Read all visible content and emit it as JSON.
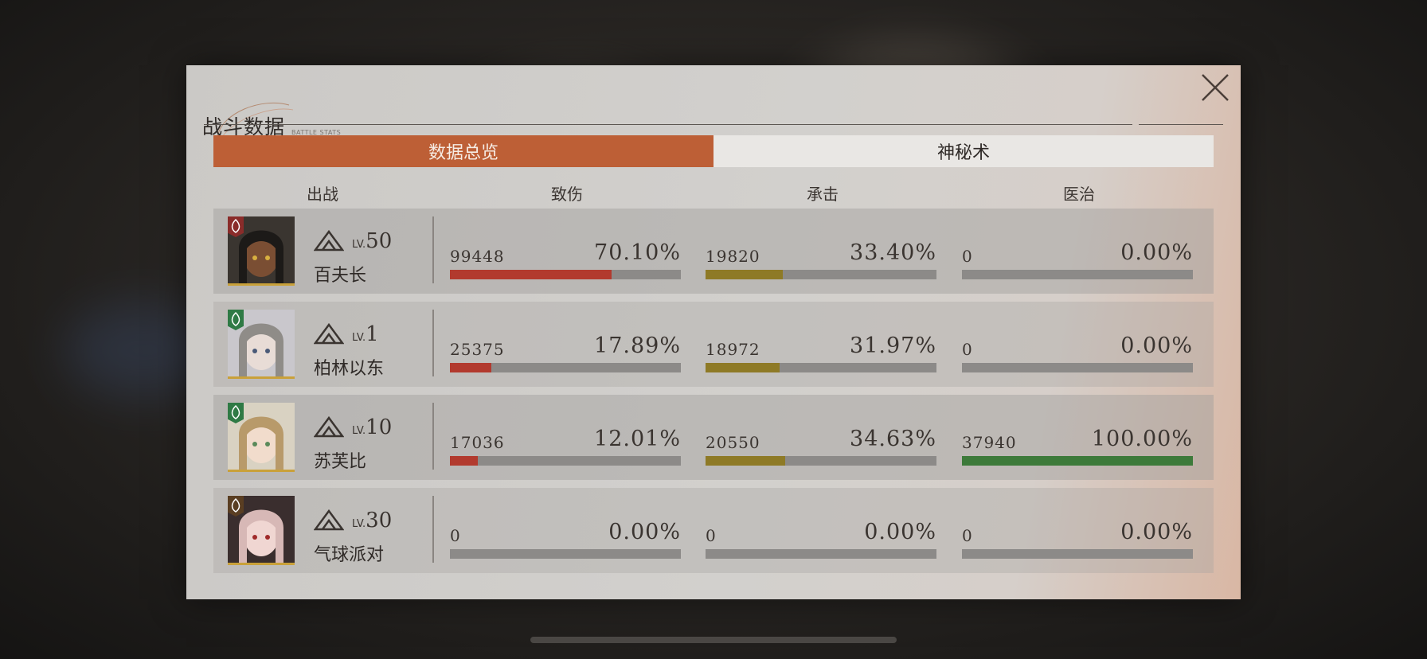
{
  "dialog": {
    "title": "战斗数据",
    "subtitle": "BATTLE STATS",
    "close_icon": "close-icon"
  },
  "tabs": [
    {
      "label": "数据总览",
      "active": true
    },
    {
      "label": "神秘术",
      "active": false
    }
  ],
  "headers": {
    "deploy": "出战",
    "damage": "致伤",
    "taken": "承击",
    "heal": "医治"
  },
  "colors": {
    "accent": "#bd5f36",
    "damage_bar": "#b23a2e",
    "taken_bar": "#8e7a26",
    "heal_bar": "#3d7a3a",
    "bar_track": "#8c8a88"
  },
  "rows": [
    {
      "name": "百夫长",
      "lv_prefix": "LV.",
      "level": "50",
      "badge_icon": "claw-badge-icon",
      "badge_color": "#8a2c2a",
      "damage": {
        "value": "99448",
        "pct": "70.10%",
        "fraction": 0.701
      },
      "taken": {
        "value": "19820",
        "pct": "33.40%",
        "fraction": 0.334
      },
      "heal": {
        "value": "0",
        "pct": "0.00%",
        "fraction": 0
      }
    },
    {
      "name": "柏林以东",
      "lv_prefix": "LV.",
      "level": "1",
      "badge_icon": "leaf-badge-icon",
      "badge_color": "#2f7a45",
      "damage": {
        "value": "25375",
        "pct": "17.89%",
        "fraction": 0.1789
      },
      "taken": {
        "value": "18972",
        "pct": "31.97%",
        "fraction": 0.3197
      },
      "heal": {
        "value": "0",
        "pct": "0.00%",
        "fraction": 0
      }
    },
    {
      "name": "苏芙比",
      "lv_prefix": "LV.",
      "level": "10",
      "badge_icon": "leaf-badge-icon",
      "badge_color": "#2f7a45",
      "damage": {
        "value": "17036",
        "pct": "12.01%",
        "fraction": 0.1201
      },
      "taken": {
        "value": "20550",
        "pct": "34.63%",
        "fraction": 0.3463
      },
      "heal": {
        "value": "37940",
        "pct": "100.00%",
        "fraction": 1.0
      }
    },
    {
      "name": "气球派对",
      "lv_prefix": "LV.",
      "level": "30",
      "badge_icon": "tower-badge-icon",
      "badge_color": "#5a3e22",
      "damage": {
        "value": "0",
        "pct": "0.00%",
        "fraction": 0
      },
      "taken": {
        "value": "0",
        "pct": "0.00%",
        "fraction": 0
      },
      "heal": {
        "value": "0",
        "pct": "0.00%",
        "fraction": 0
      }
    }
  ]
}
